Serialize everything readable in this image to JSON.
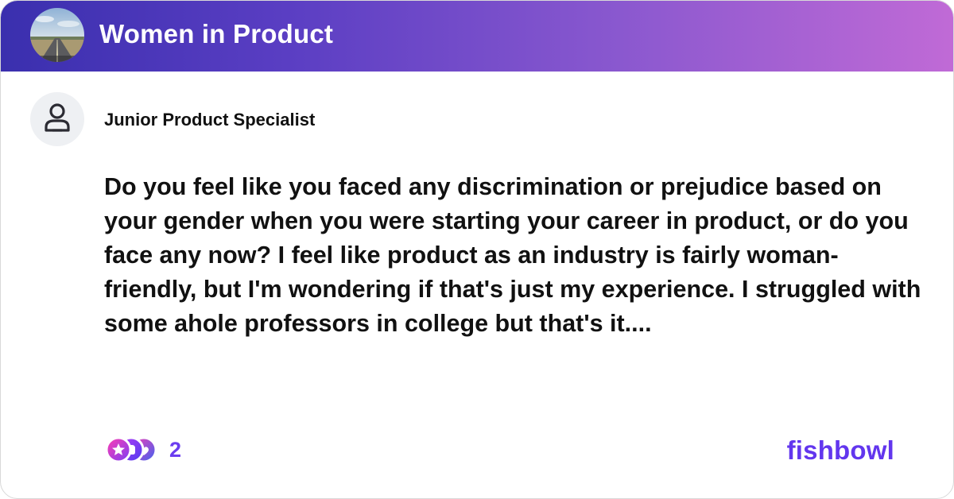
{
  "header": {
    "group_name": "Women in Product",
    "group_avatar_icon": "road-landscape-photo",
    "gradient_start": "#3a2fae",
    "gradient_end": "#c06ad6"
  },
  "post": {
    "author_title": "Junior Product Specialist",
    "author_avatar_icon": "person-icon",
    "body": "Do you feel like you faced any discrimination or prejudice based on your gender when you were starting your career in product, or do you face any now? I feel like product as an industry is fairly woman-friendly, but I'm wondering if that's just my experience. I struggled with some ahole professors in college but that's it...."
  },
  "footer": {
    "reaction_count": "2",
    "reaction_icons": [
      "star-reaction-icon",
      "clap-reaction-icon",
      "heart-reaction-icon"
    ],
    "brand_name": "fishbowl",
    "brand_color": "#6236ee"
  }
}
